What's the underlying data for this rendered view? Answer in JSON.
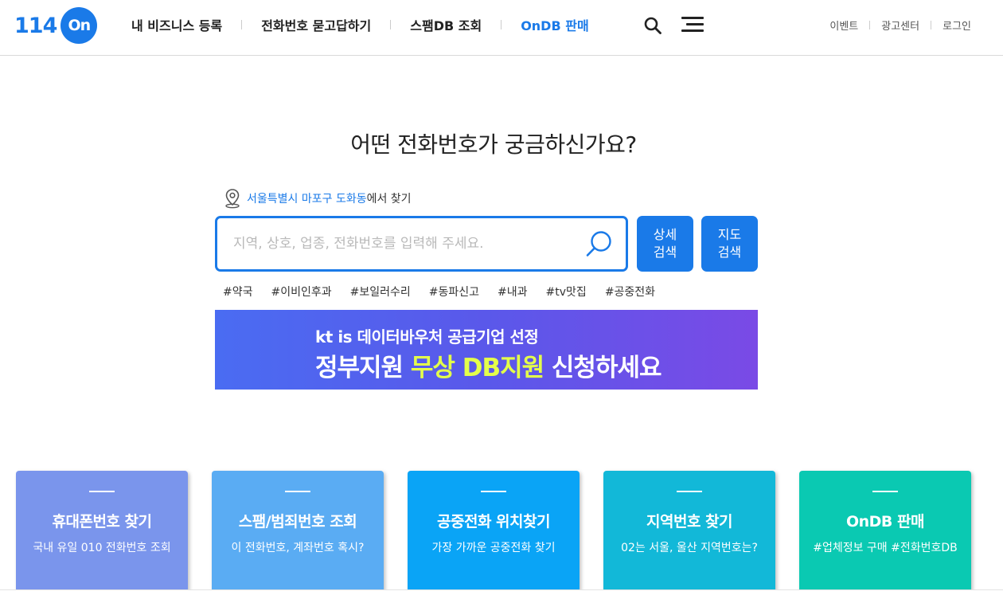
{
  "logo": {
    "number": "114",
    "circle_text": "On"
  },
  "nav": {
    "items": [
      {
        "label": "내 비즈니스 등록"
      },
      {
        "label": "전화번호 묻고답하기"
      },
      {
        "label": "스팸DB 조회"
      },
      {
        "label": "OnDB 판매"
      }
    ]
  },
  "util": {
    "event": "이벤트",
    "ad_center": "광고센터",
    "login": "로그인"
  },
  "main": {
    "headline": "어떤 전화번호가 궁금하신가요?",
    "location": {
      "place": "서울특별시 마포구 도화동",
      "suffix": "에서 찾기"
    },
    "search": {
      "placeholder": "지역, 상호, 업종, 전화번호를 입력해 주세요."
    },
    "detail_button": {
      "line1": "상세",
      "line2": "검색"
    },
    "map_button": {
      "line1": "지도",
      "line2": "검색"
    },
    "tags": [
      "#약국",
      "#이비인후과",
      "#보일러수리",
      "#동파신고",
      "#내과",
      "#tv맛집",
      "#공중전화"
    ]
  },
  "banner": {
    "line1": "kt is 데이터바우처 공급기업 선정",
    "line2_a": "정부지원 ",
    "line2_b": "무상 DB지원",
    "line2_c": " 신청하세요"
  },
  "cards": [
    {
      "title": "휴대폰번호 찾기",
      "sub": "국내 유일 010 전화번호 조회",
      "color": "#7a95ec"
    },
    {
      "title": "스팸/범죄번호 조회",
      "sub": "이 전화번호, 계좌번호 혹시?",
      "color": "#5aacf3"
    },
    {
      "title": "공중전화 위치찾기",
      "sub": "가장 가까운 공중전화 찾기",
      "color": "#0aa4f6"
    },
    {
      "title": "지역번호 찾기",
      "sub": "02는 서울, 울산 지역번호는?",
      "color": "#12b8d8"
    },
    {
      "title": "OnDB 판매",
      "sub": "#업체정보 구매 #전화번호DB",
      "color": "#0ac9b2"
    }
  ],
  "colors": {
    "brand": "#1a7ae8",
    "banner_highlight": "#e4ff4a"
  }
}
